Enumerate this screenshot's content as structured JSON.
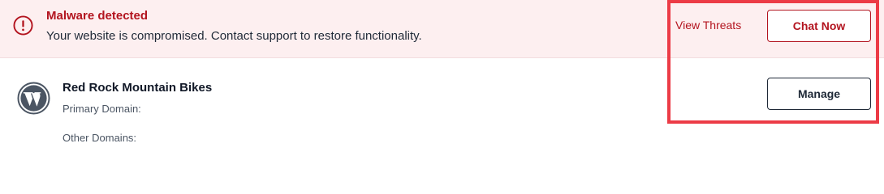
{
  "alert": {
    "title": "Malware detected",
    "message": "Your website is compromised. Contact support to restore functionality.",
    "icon": "alert-circle-icon",
    "view_threats_label": "View Threats",
    "chat_now_label": "Chat Now",
    "accent_color": "#b3141f",
    "background_color": "#fdeff0"
  },
  "site": {
    "name": "Red Rock Mountain Bikes",
    "icon": "wordpress-icon",
    "primary_domain_label": "Primary Domain:",
    "other_domains_label": "Other Domains:",
    "manage_label": "Manage"
  },
  "highlight": {
    "color": "#ec3b46"
  }
}
